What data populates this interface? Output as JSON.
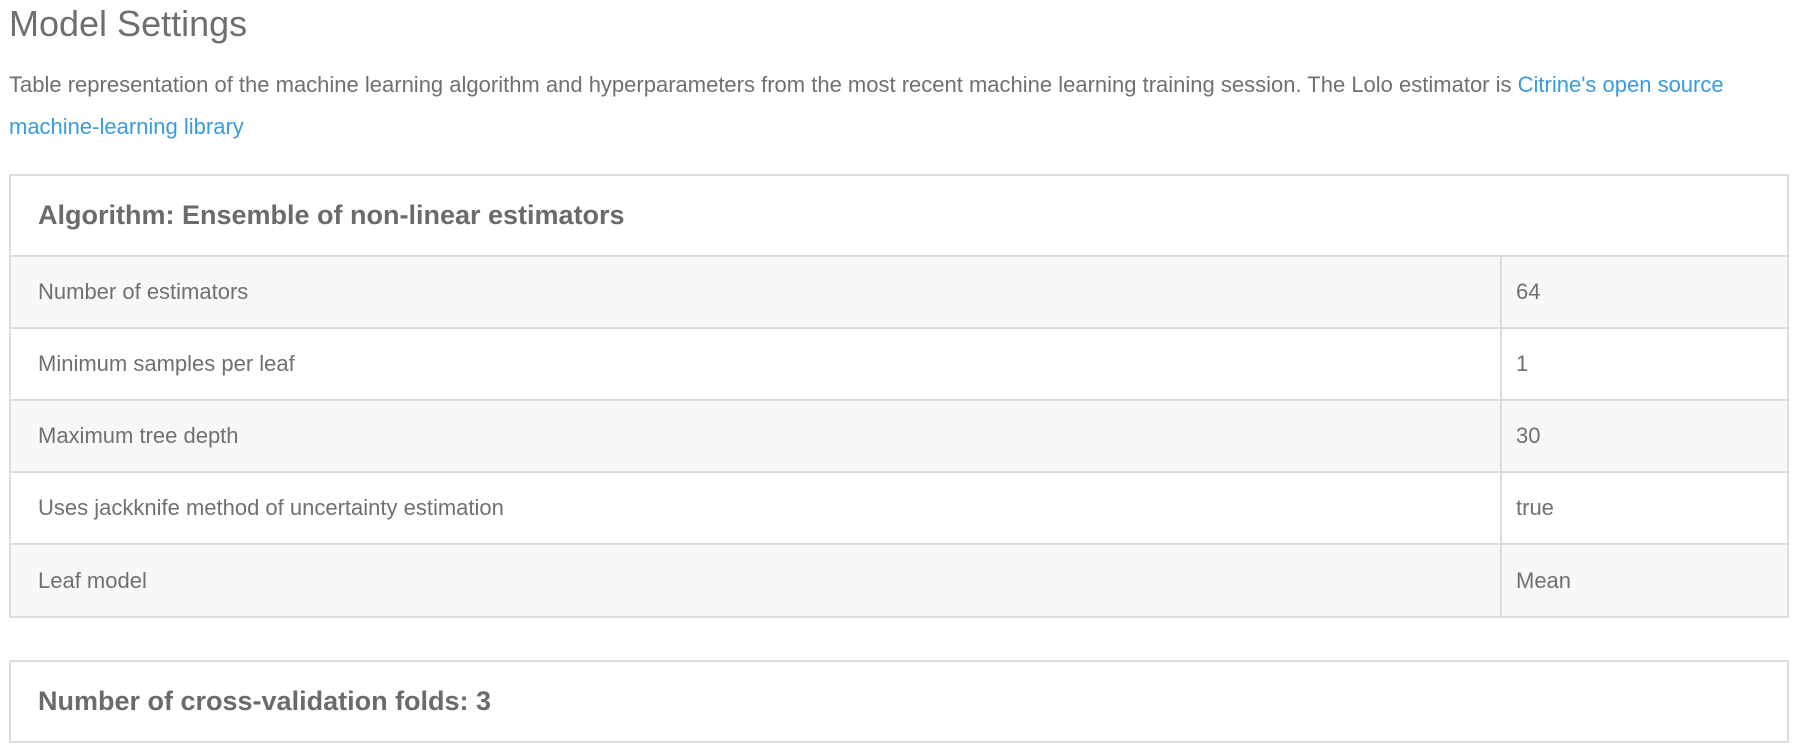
{
  "page": {
    "title": "Model Settings",
    "description": "Table representation of the machine learning algorithm and hyperparameters from the most recent machine learning training session. The Lolo estimator is ",
    "link_text": "Citrine's open source machine-learning library"
  },
  "algorithm_panel": {
    "heading": "Algorithm: Ensemble of non-linear estimators",
    "rows": [
      {
        "name": "Number of estimators",
        "value": "64"
      },
      {
        "name": "Minimum samples per leaf",
        "value": "1"
      },
      {
        "name": "Maximum tree depth",
        "value": "30"
      },
      {
        "name": "Uses jackknife method of uncertainty estimation",
        "value": "true"
      },
      {
        "name": "Leaf model",
        "value": "Mean"
      }
    ]
  },
  "cv_panel": {
    "heading": "Number of cross-validation folds: 3"
  },
  "colors": {
    "link": "#3a9be0",
    "text": "#707070",
    "border": "#dddddd",
    "row_stripe": "#f8f8f8"
  }
}
